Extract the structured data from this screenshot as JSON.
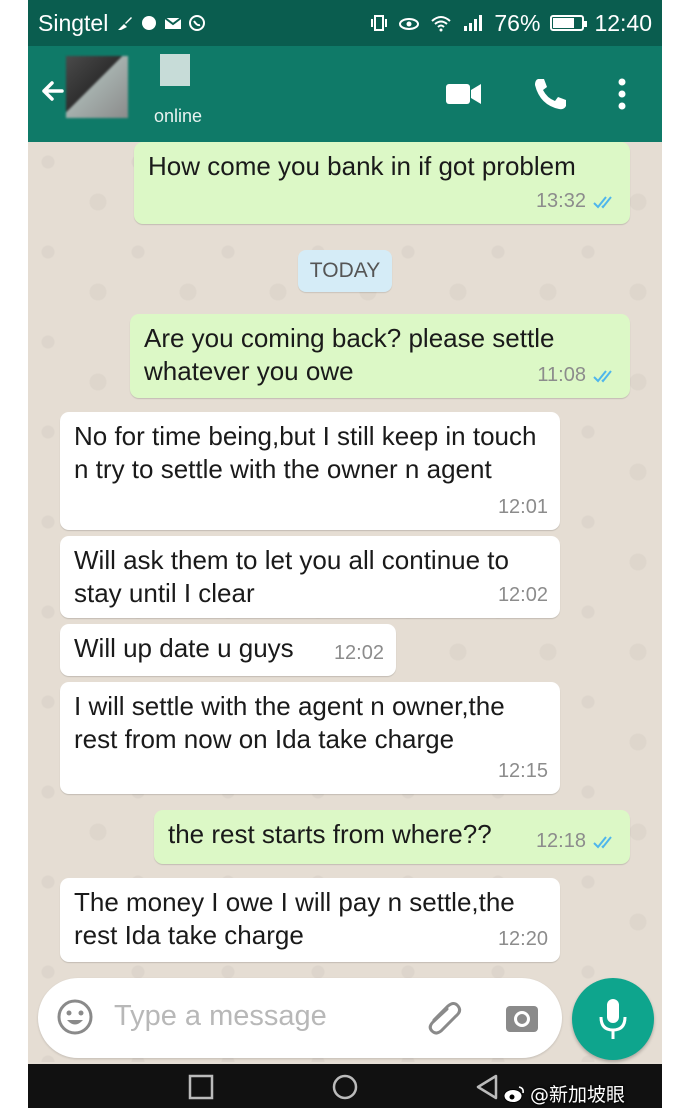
{
  "status_bar": {
    "carrier": "Singtel",
    "battery": "76%",
    "battery_level": 0.76,
    "time": "12:40"
  },
  "header": {
    "contact_status": "online",
    "icons": [
      "back-arrow-icon",
      "video-call-icon",
      "phone-call-icon",
      "more-vert-icon"
    ]
  },
  "chat": {
    "date_separator": "TODAY",
    "messages": [
      {
        "direction": "out",
        "text": "How come you bank in if got problem",
        "time": "13:32",
        "read": true
      },
      {
        "direction": "out",
        "text": "Are you coming back? please settle whatever you owe",
        "time": "11:08",
        "read": true
      },
      {
        "direction": "in",
        "text": "No for time being,but I still keep in touch n try to settle with the owner n agent",
        "time": "12:01"
      },
      {
        "direction": "in",
        "text": "Will ask them to let you all continue to stay until I clear",
        "time": "12:02"
      },
      {
        "direction": "in",
        "text": "Will up date u guys",
        "time": "12:02"
      },
      {
        "direction": "in",
        "text": "I will settle with the agent n owner,the rest from now on Ida take charge",
        "time": "12:15"
      },
      {
        "direction": "out",
        "text": "the rest starts from where??",
        "time": "12:18",
        "read": true
      },
      {
        "direction": "in",
        "text": "The money I owe I will pay n settle,the rest Ida take charge",
        "time": "12:20"
      }
    ]
  },
  "composer": {
    "placeholder": "Type a message",
    "icons": [
      "emoji-icon",
      "attach-icon",
      "camera-icon",
      "mic-icon"
    ]
  },
  "watermark": {
    "text": "@新加坡眼"
  },
  "colors": {
    "status_bar": "#0a5d4f",
    "app_bar": "#0f7a68",
    "outgoing_bubble": "#dcf8c6",
    "incoming_bubble": "#ffffff",
    "read_ticks": "#4fb6ec",
    "mic_button": "#0ea58d"
  }
}
